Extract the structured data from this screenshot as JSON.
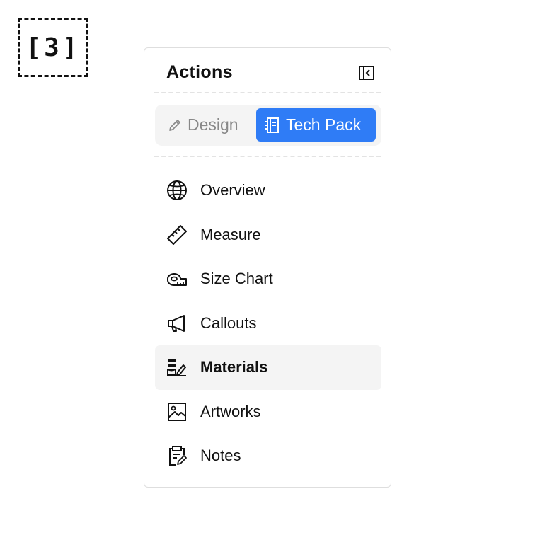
{
  "step_badge": "[3]",
  "panel": {
    "title": "Actions",
    "collapse_icon": "sidebar-collapse-icon"
  },
  "mode_toggle": {
    "options": [
      {
        "label": "Design",
        "icon": "pencil-icon",
        "selected": false
      },
      {
        "label": "Tech Pack",
        "icon": "notebook-icon",
        "selected": true
      }
    ],
    "selected_color": "#2f7cf6"
  },
  "menu": {
    "items": [
      {
        "label": "Overview",
        "icon": "globe-icon",
        "active": false
      },
      {
        "label": "Measure",
        "icon": "ruler-icon",
        "active": false
      },
      {
        "label": "Size Chart",
        "icon": "measuring-tape-icon",
        "active": false
      },
      {
        "label": "Callouts",
        "icon": "megaphone-icon",
        "active": false
      },
      {
        "label": "Materials",
        "icon": "materials-icon",
        "active": true
      },
      {
        "label": "Artworks",
        "icon": "image-icon",
        "active": false
      },
      {
        "label": "Notes",
        "icon": "clipboard-edit-icon",
        "active": false
      }
    ]
  }
}
